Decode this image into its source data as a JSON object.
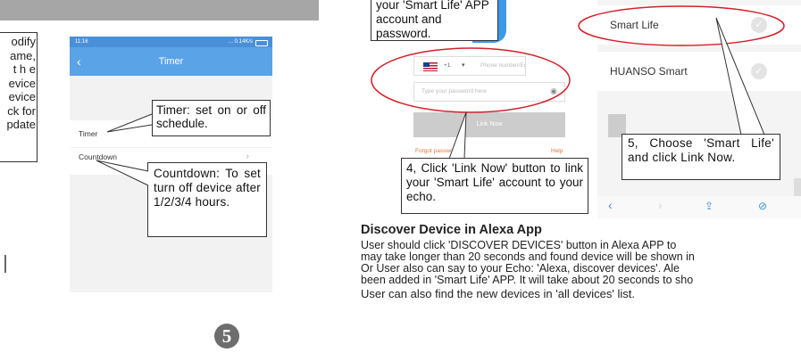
{
  "left_panel": {
    "partial_lines": [
      "odify",
      "ame,",
      "t h e",
      "evice",
      "evice",
      "ck  for",
      "pdate"
    ]
  },
  "timer_phone": {
    "status_time": "11:16",
    "status_right": "... 0.14K/s",
    "back_icon": "back-chevron-icon",
    "title": "Timer",
    "row_timer": "Timer",
    "row_countdown": "Countdown",
    "callout_timer": "Timer: set on or off schedule.",
    "callout_countdown": "Countdown: To set turn off device after 1/2/3/4 hours."
  },
  "page_number": "5",
  "link_phone": {
    "top_callout": "your 'Smart Life' APP account and password.",
    "country_code": "+1",
    "phone_placeholder": "Phone number/Email Ad",
    "password_placeholder": "Type your password here",
    "link_button": "Link Now",
    "forgot_link": "Forgot password",
    "help_link": "Help",
    "callout": "4, Click 'Link Now' button to link your 'Smart Life' account to your echo."
  },
  "skill_list": {
    "items": [
      "Smart Life",
      "HUANSO Smart"
    ],
    "callout": "5, Choose 'Smart Life' and click Link Now."
  },
  "discover": {
    "heading": "Discover Device in Alexa App",
    "lines": [
      "User should click 'DISCOVER DEVICES' button in Alexa APP to",
      "may take longer than 20 seconds and found device will be shown in",
      "Or User also can say to your Echo: 'Alexa, discover devices'. Ale",
      "been added in 'Smart Life' APP. It will take about 20 seconds to sho",
      "User can also find the new devices in 'all devices' list."
    ]
  },
  "colors": {
    "accent": "#5aa3e6",
    "highlight": "#d4202a",
    "link_orange": "#e8733a"
  }
}
